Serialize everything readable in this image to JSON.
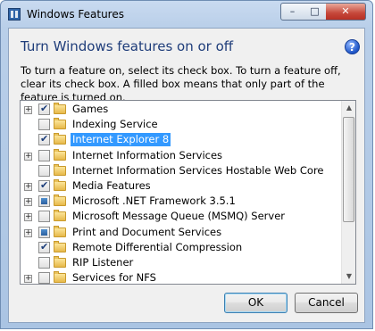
{
  "window": {
    "title": "Windows Features",
    "controls": {
      "minimize": "–",
      "maximize": "□",
      "close": "✕"
    }
  },
  "dialog": {
    "heading": "Turn Windows features on or off",
    "description": "To turn a feature on, select its check box. To turn a feature off, clear its check box. A filled box means that only part of the feature is turned on.",
    "help_icon": "?"
  },
  "features": [
    {
      "label": "Games",
      "state": "checked",
      "expandable": true
    },
    {
      "label": "Indexing Service",
      "state": "unchecked",
      "expandable": false
    },
    {
      "label": "Internet Explorer 8",
      "state": "checked",
      "expandable": false,
      "selected": true
    },
    {
      "label": "Internet Information Services",
      "state": "unchecked",
      "expandable": true
    },
    {
      "label": "Internet Information Services Hostable Web Core",
      "state": "unchecked",
      "expandable": false
    },
    {
      "label": "Media Features",
      "state": "checked",
      "expandable": true
    },
    {
      "label": "Microsoft .NET Framework 3.5.1",
      "state": "partial",
      "expandable": true
    },
    {
      "label": "Microsoft Message Queue (MSMQ) Server",
      "state": "unchecked",
      "expandable": true
    },
    {
      "label": "Print and Document Services",
      "state": "partial",
      "expandable": true
    },
    {
      "label": "Remote Differential Compression",
      "state": "checked",
      "expandable": false
    },
    {
      "label": "RIP Listener",
      "state": "unchecked",
      "expandable": false
    },
    {
      "label": "Services for NFS",
      "state": "unchecked",
      "expandable": true
    }
  ],
  "buttons": {
    "ok": "OK",
    "cancel": "Cancel"
  }
}
